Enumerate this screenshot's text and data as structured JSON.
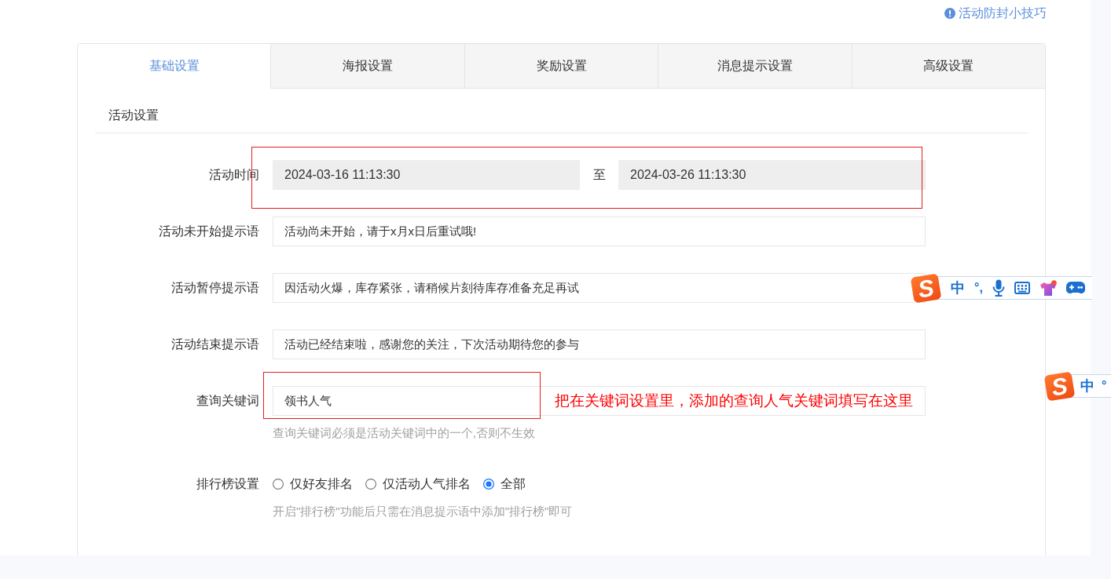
{
  "tip": {
    "text": "活动防封小技巧"
  },
  "tabs": [
    {
      "label": "基础设置",
      "selected": true
    },
    {
      "label": "海报设置",
      "selected": false
    },
    {
      "label": "奖励设置",
      "selected": false
    },
    {
      "label": "消息提示设置",
      "selected": false
    },
    {
      "label": "高级设置",
      "selected": false
    }
  ],
  "section": {
    "title": "活动设置"
  },
  "form": {
    "rows": [
      {
        "kind": "daterange",
        "label": "活动时间",
        "start": "2024-03-16 11:13:30",
        "separator": "至",
        "end": "2024-03-26 11:13:30",
        "disabled": true,
        "highlighted": true
      },
      {
        "kind": "text",
        "label": "活动未开始提示语",
        "value": "活动尚未开始，请于x月x日后重试哦!",
        "disabled": false,
        "highlighted": false
      },
      {
        "kind": "text",
        "label": "活动暂停提示语",
        "value": "因活动火爆，库存紧张，请稍候片刻待库存准备充足再试",
        "disabled": false,
        "highlighted": false
      },
      {
        "kind": "text",
        "label": "活动结束提示语",
        "value": "活动已经结束啦，感谢您的关注，下次活动期待您的参与",
        "disabled": false,
        "highlighted": false
      },
      {
        "kind": "text",
        "label": "查询关键词",
        "value": "领书人气",
        "disabled": false,
        "highlighted": true,
        "note": "把在关键词设置里，添加的查询人气关键词填写在这里",
        "hint": "查询关键词必须是活动关键词中的一个,否则不生效"
      },
      {
        "kind": "radio",
        "label": "排行榜设置",
        "disabled": false,
        "highlighted": false,
        "options": [
          {
            "label": "仅好友排名",
            "selected": false
          },
          {
            "label": "仅活动人气排名",
            "selected": false
          },
          {
            "label": "全部",
            "selected": true
          }
        ],
        "hint": "开启\"排行榜\"功能后只需在消息提示语中添加\"排行榜\"即可"
      }
    ]
  },
  "ime_toolbars": [
    {
      "kind": "full",
      "logo": "S",
      "mode": "中",
      "punctuation": "°,"
    },
    {
      "kind": "cut",
      "logo": "S",
      "mode": "中",
      "punctuation": "°"
    }
  ]
}
